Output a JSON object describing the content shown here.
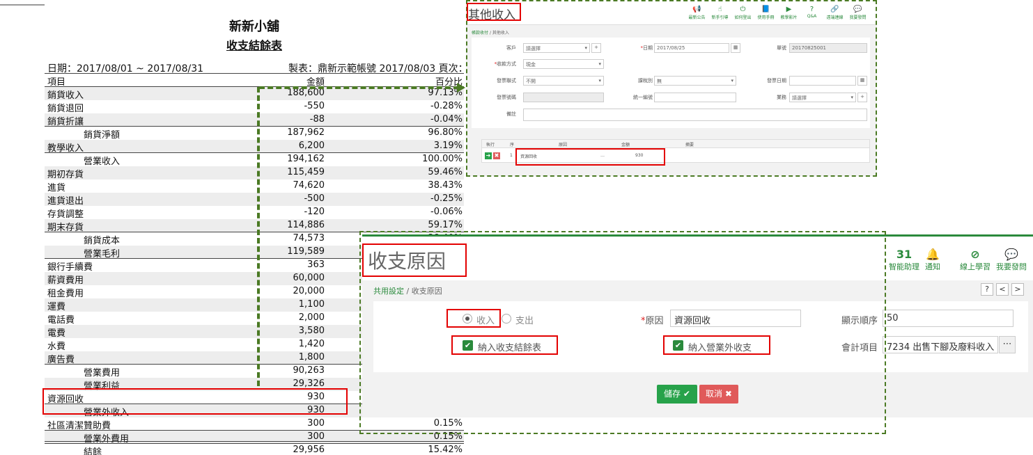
{
  "report": {
    "store": "新新小舖",
    "title": "收支結餘表",
    "date_range": "日期：2017/08/01 ~ 2017/08/31",
    "maker": "製表：鼎新示範帳號 2017/08/03 頁次：1",
    "headers": {
      "item": "項目",
      "amount": "金額",
      "percent": "百分比"
    },
    "rows": [
      {
        "label": "銷貨收入",
        "amount": "188,600",
        "pct": "97.13%",
        "indent": false,
        "alt": true
      },
      {
        "label": "銷貨退回",
        "amount": "-550",
        "pct": "-0.28%",
        "indent": false,
        "alt": false
      },
      {
        "label": "銷貨折讓",
        "amount": "-88",
        "pct": "-0.04%",
        "indent": false,
        "alt": true
      },
      {
        "label": "銷貨淨額",
        "amount": "187,962",
        "pct": "96.80%",
        "indent": true,
        "alt": false
      },
      {
        "label": "教學收入",
        "amount": "6,200",
        "pct": "3.19%",
        "indent": false,
        "alt": true
      },
      {
        "label": "營業收入",
        "amount": "194,162",
        "pct": "100.00%",
        "indent": true,
        "alt": false
      },
      {
        "label": "期初存貨",
        "amount": "115,459",
        "pct": "59.46%",
        "indent": false,
        "alt": true
      },
      {
        "label": "進貨",
        "amount": "74,620",
        "pct": "38.43%",
        "indent": false,
        "alt": false
      },
      {
        "label": "進貨退出",
        "amount": "-500",
        "pct": "-0.25%",
        "indent": false,
        "alt": true
      },
      {
        "label": "存貨調整",
        "amount": "-120",
        "pct": "-0.06%",
        "indent": false,
        "alt": false
      },
      {
        "label": "期末存貨",
        "amount": "114,886",
        "pct": "59.17%",
        "indent": false,
        "alt": true
      },
      {
        "label": "銷貨成本",
        "amount": "74,573",
        "pct": "38.40%",
        "indent": true,
        "alt": false
      },
      {
        "label": "營業毛利",
        "amount": "119,589",
        "pct": "",
        "indent": true,
        "alt": true
      },
      {
        "label": "銀行手續費",
        "amount": "363",
        "pct": "",
        "indent": false,
        "alt": false
      },
      {
        "label": "薪資費用",
        "amount": "60,000",
        "pct": "",
        "indent": false,
        "alt": true
      },
      {
        "label": "租金費用",
        "amount": "20,000",
        "pct": "",
        "indent": false,
        "alt": false
      },
      {
        "label": "運費",
        "amount": "1,100",
        "pct": "",
        "indent": false,
        "alt": true
      },
      {
        "label": "電話費",
        "amount": "2,000",
        "pct": "",
        "indent": false,
        "alt": false
      },
      {
        "label": "電費",
        "amount": "3,580",
        "pct": "",
        "indent": false,
        "alt": true
      },
      {
        "label": "水費",
        "amount": "1,420",
        "pct": "",
        "indent": false,
        "alt": false
      },
      {
        "label": "廣告費",
        "amount": "1,800",
        "pct": "",
        "indent": false,
        "alt": true
      },
      {
        "label": "營業費用",
        "amount": "90,263",
        "pct": "",
        "indent": true,
        "alt": false
      },
      {
        "label": "營業利益",
        "amount": "29,326",
        "pct": "",
        "indent": true,
        "alt": true
      },
      {
        "label": "資源回收",
        "amount": "930",
        "pct": "",
        "indent": false,
        "alt": false
      },
      {
        "label": "營業外收入",
        "amount": "930",
        "pct": "",
        "indent": true,
        "alt": true
      },
      {
        "label": "社區清潔贊助費",
        "amount": "300",
        "pct": "0.15%",
        "indent": false,
        "alt": false
      },
      {
        "label": "營業外費用",
        "amount": "300",
        "pct": "0.15%",
        "indent": true,
        "alt": true
      },
      {
        "label": "結餘",
        "amount": "29,956",
        "pct": "15.42%",
        "indent": true,
        "alt": false
      }
    ]
  },
  "win1": {
    "title": "其他收入",
    "icons": [
      {
        "name": "megaphone-icon",
        "glyph": "📢",
        "label": "最新公告"
      },
      {
        "name": "hand-pointer-icon",
        "glyph": "☝",
        "label": "新手引導"
      },
      {
        "name": "power-icon",
        "glyph": "⏻",
        "label": "如何登出"
      },
      {
        "name": "book-icon",
        "glyph": "📘",
        "label": "使用手冊"
      },
      {
        "name": "video-icon",
        "glyph": "▶",
        "label": "教學影片"
      },
      {
        "name": "question-icon",
        "glyph": "?",
        "label": "Q&A"
      },
      {
        "name": "link-icon",
        "glyph": "🔗",
        "label": "遠端連線"
      },
      {
        "name": "chat-icon",
        "glyph": "💬",
        "label": "我要發問"
      }
    ],
    "breadcrumb_root": "帳款收付",
    "breadcrumb_sep": "/",
    "breadcrumb_current": "其他收入",
    "customer_label": "客戶",
    "customer_placeholder": "請選擇",
    "date_label": "日期",
    "date_value": "2017/08/25",
    "doc_label": "單號",
    "doc_value": "20170825001",
    "payment_label": "收款方式",
    "payment_value": "現金",
    "invoice_type_label": "發票聯式",
    "invoice_type_value": "不開",
    "tax_label": "課稅別",
    "tax_value": "無",
    "invoice_date_label": "發票日期",
    "invoice_no_label": "發票號碼",
    "unified_label": "統一編號",
    "sales_label": "業務",
    "sales_placeholder": "請選擇",
    "remark_label": "備註",
    "grid": {
      "headers": {
        "exec": "執行",
        "seq": "序",
        "reason": "原因",
        "amount": "金額",
        "summary": "摘要"
      },
      "row": {
        "seq": "1",
        "reason": "資源回收",
        "amount": "930",
        "dash": "…"
      }
    }
  },
  "win2": {
    "title": "收支原因",
    "icons": [
      {
        "name": "calendar-icon",
        "glyph": "31",
        "label": "智能助理"
      },
      {
        "name": "bell-icon",
        "glyph": "🔔",
        "label": "通知"
      },
      {
        "name": "compass-icon",
        "glyph": "⊘",
        "label": "線上學習"
      },
      {
        "name": "chat-icon",
        "glyph": "💬",
        "label": "我要發問"
      }
    ],
    "breadcrumb_root": "共用設定",
    "breadcrumb_sep": "/",
    "breadcrumb_current": "收支原因",
    "nav_help": "?",
    "nav_prev": "<",
    "nav_next": ">",
    "income_label": "收入",
    "expense_label": "支出",
    "reason_label": "原因",
    "reason_value": "資源回收",
    "order_label": "顯示順序",
    "order_value": "50",
    "include_report_label": "納入收支結餘表",
    "include_nonop_label": "納入營業外收支",
    "account_label": "會計項目",
    "account_value": "7234 出售下腳及廢料收入",
    "save_label": "儲存",
    "cancel_label": "取消"
  },
  "colors": {
    "green": "#2a8a3c",
    "red": "#e30000",
    "dash": "#4b7a24",
    "save": "#27a24a",
    "cancel": "#e05a5a"
  }
}
